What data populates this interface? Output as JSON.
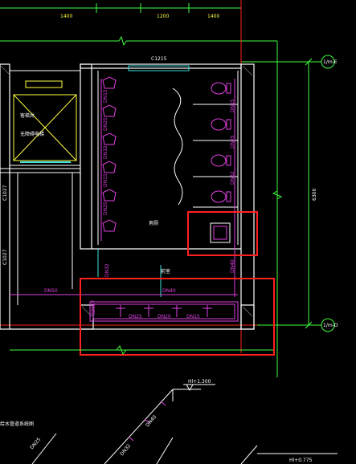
{
  "dimensions": {
    "top_left": "1400",
    "top_mid": "1200",
    "top_right": "1400",
    "right_vertical": "6300"
  },
  "axis_marks": {
    "upper": "1/m-E",
    "lower": "1/m-D"
  },
  "labels": {
    "c1215": "C1215",
    "elevator_line1": "客梯井",
    "elevator_line2": "无障碍电梯",
    "c1027_upper": "C1027",
    "c1027_lower": "C1027",
    "mens_room": "男厕",
    "wash": "前室",
    "cw2_upper": "C2027"
  },
  "pipe_labels": {
    "dn50_left": "DN50",
    "dn40_mid": "DN40",
    "dn32_left": "DN32",
    "dn40_right": "DN40",
    "dn25_a": "DN25",
    "dn20_a": "DN20",
    "dn15_a": "DN15",
    "left_col": [
      "DN15",
      "DN25",
      "DN32",
      "DN15",
      "DN25",
      "DN32"
    ],
    "right_col": [
      "DN15",
      "DN25",
      "DN32",
      "DN40"
    ],
    "bottom_left": "DN25",
    "bottom_mid1": "DN20",
    "bottom_mid2": "DN15"
  },
  "elevations": {
    "upper": "Hl+1.300",
    "lower": "Hl+0.775"
  },
  "annotation_bottom_left": "给水管道系统图",
  "riser_labels": [
    "DN40",
    "DN32",
    "DN25"
  ],
  "colors": {
    "background": "#000000",
    "wall": "#ffffff",
    "pipe": "#e040e0",
    "highlight": "#ff2020",
    "dim": "#40ff40",
    "cyan": "#40e0e0",
    "yellow": "#ffff40"
  }
}
